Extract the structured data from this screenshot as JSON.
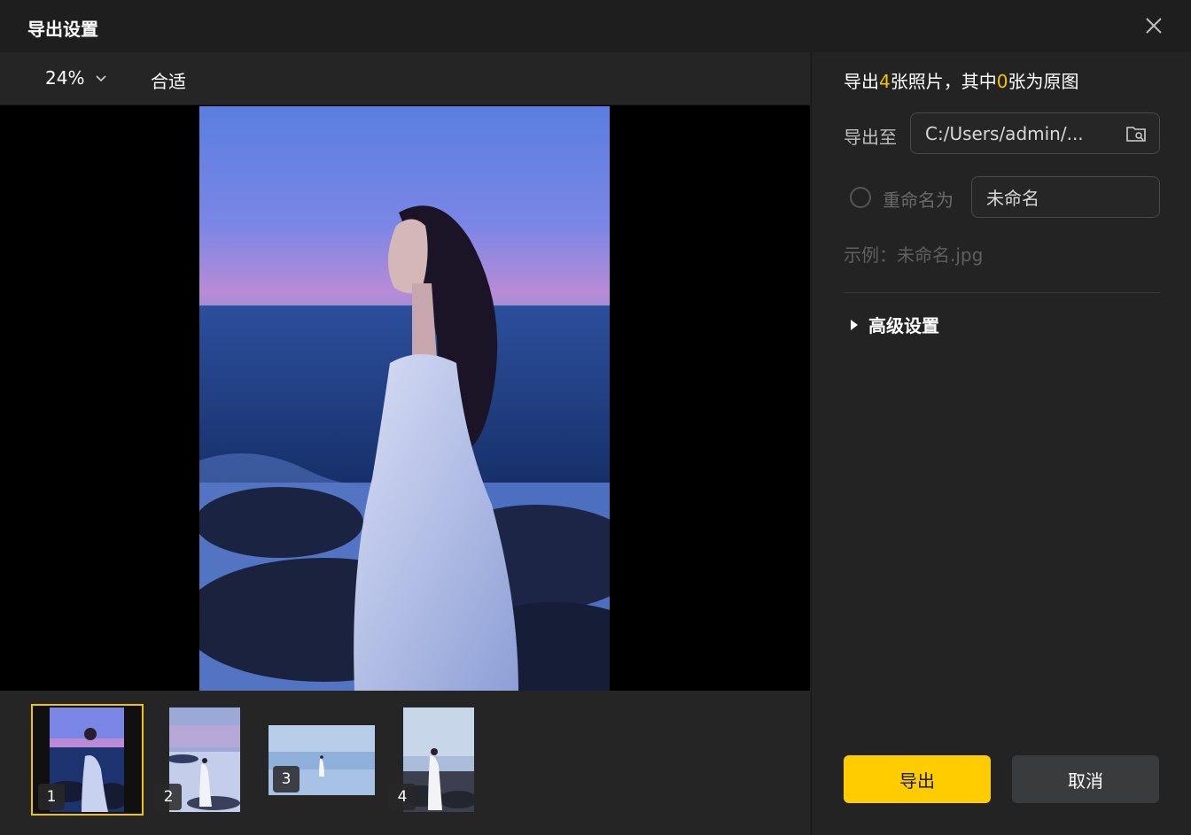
{
  "dialog": {
    "title": "导出设置",
    "accent_color": "#ffcc00"
  },
  "preview": {
    "zoom": "24%",
    "fit_label": "合适",
    "thumbnails": [
      {
        "number": "1",
        "selected": true
      },
      {
        "number": "2",
        "selected": false
      },
      {
        "number": "3",
        "selected": false
      },
      {
        "number": "4",
        "selected": false
      }
    ]
  },
  "settings": {
    "summary_prefix": "导出",
    "photo_count": "4",
    "summary_middle": "张照片，其中",
    "original_count": "0",
    "summary_suffix": "张为原图",
    "export_to_label": "导出至",
    "export_path": "C:/Users/admin/...",
    "rename_label": "重命名为",
    "rename_value": "未命名",
    "example_text": "示例：未命名.jpg",
    "advanced_label": "高级设置",
    "export_button": "导出",
    "cancel_button": "取消"
  }
}
